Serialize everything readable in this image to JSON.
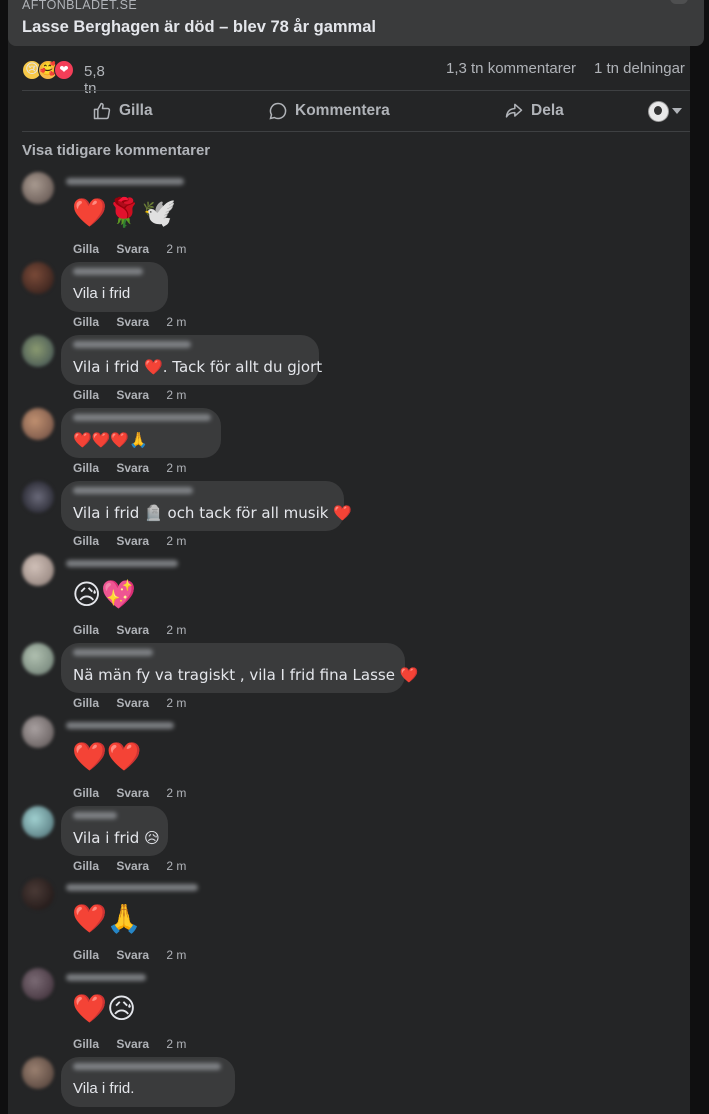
{
  "link_preview": {
    "domain": "AFTONBLADET.SE",
    "title": "Lasse Berghagen är död – blev 78 år gammal"
  },
  "stats": {
    "reactions": [
      "😢",
      "🥰",
      "❤"
    ],
    "reaction_count": "5,8 tn",
    "comments": "1,3 tn kommentarer",
    "shares": "1 tn delningar"
  },
  "actions": {
    "like": "Gilla",
    "comment": "Kommentera",
    "share": "Dela"
  },
  "earlier_comments": "Visa tidigare kommentarer",
  "comment_meta": {
    "like": "Gilla",
    "reply": "Svara",
    "time": "2 m"
  },
  "comments": [
    {
      "text": "❤️🌹🕊️",
      "type": "emoji"
    },
    {
      "text": "Vila i frid",
      "type": "bubble"
    },
    {
      "text": "Vila i frid ❤️. Tack för allt du gjort",
      "type": "bubble"
    },
    {
      "text": "❤️❤️❤️🙏",
      "type": "bubble"
    },
    {
      "text": "Vila i frid 🪦 och tack för all musik ❤️",
      "type": "bubble"
    },
    {
      "text": "😥💖",
      "type": "emoji"
    },
    {
      "text": "Nä män fy va tragiskt , vila I frid fina Lasse ❤️",
      "type": "bubble"
    },
    {
      "text": "❤️❤️",
      "type": "emoji"
    },
    {
      "text": "Vila i frid 😥",
      "type": "bubble"
    },
    {
      "text": "❤️🙏",
      "type": "emoji"
    },
    {
      "text": "❤️😥",
      "type": "emoji"
    },
    {
      "text": "Vila i frid.",
      "type": "bubble"
    }
  ],
  "colors": {
    "panel": "#242526",
    "bubble": "#3a3b3c",
    "text": "#e4e6eb",
    "secondary": "#b0b3b8"
  }
}
